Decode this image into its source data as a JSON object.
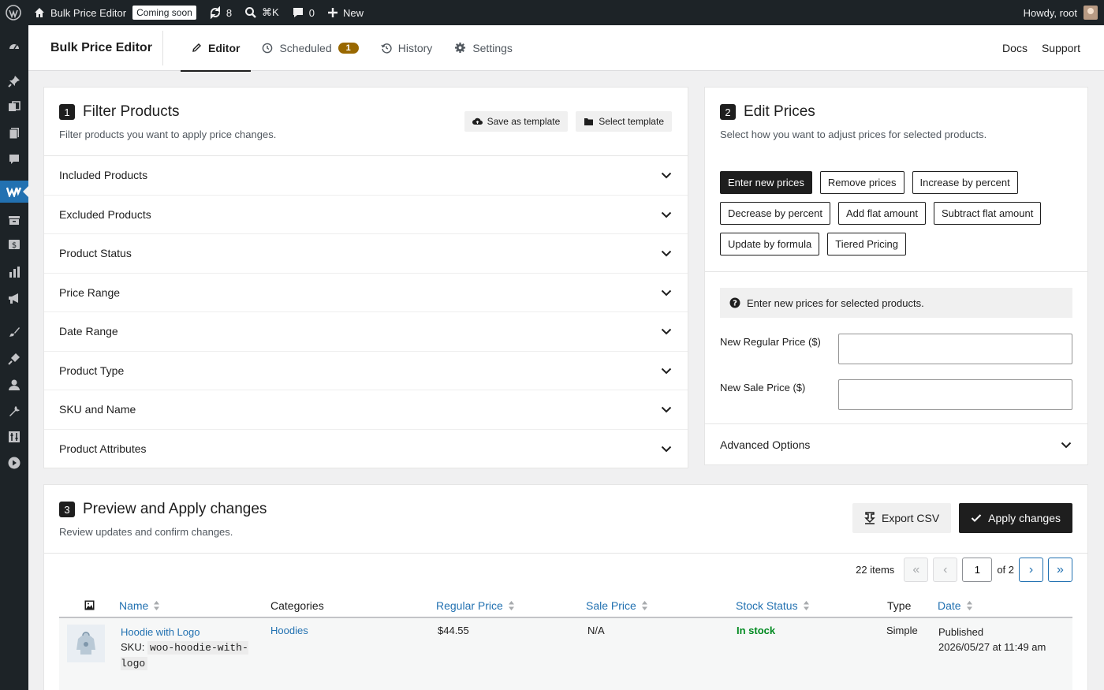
{
  "adminbar": {
    "site_name": "Bulk Price Editor",
    "badge": "Coming soon",
    "updates_count": "8",
    "search_shortcut": "⌘K",
    "comments_count": "0",
    "new_label": "New",
    "howdy": "Howdy, root"
  },
  "header": {
    "title": "Bulk Price Editor",
    "tabs": [
      {
        "label": "Editor",
        "icon": "pencil-icon"
      },
      {
        "label": "Scheduled",
        "icon": "clock-icon",
        "count": "1"
      },
      {
        "label": "History",
        "icon": "history-icon"
      },
      {
        "label": "Settings",
        "icon": "gear-icon"
      }
    ],
    "links": {
      "docs": "Docs",
      "support": "Support"
    }
  },
  "filter": {
    "step": "1",
    "title": "Filter Products",
    "subtitle": "Filter products you want to apply price changes.",
    "save_template": "Save as template",
    "select_template": "Select template",
    "sections": [
      "Included Products",
      "Excluded Products",
      "Product Status",
      "Price Range",
      "Date Range",
      "Product Type",
      "SKU and Name",
      "Product Attributes"
    ]
  },
  "edit": {
    "step": "2",
    "title": "Edit Prices",
    "subtitle": "Select how you want to adjust prices for selected products.",
    "modes": [
      "Enter new prices",
      "Remove prices",
      "Increase by percent",
      "Decrease by percent",
      "Add flat amount",
      "Subtract flat amount",
      "Update by formula",
      "Tiered Pricing"
    ],
    "active_mode": "Enter new prices",
    "info": "Enter new prices for selected products.",
    "regular_label": "New Regular Price ($)",
    "regular_value": "",
    "sale_label": "New Sale Price ($)",
    "sale_value": "",
    "advanced": "Advanced Options"
  },
  "preview": {
    "step": "3",
    "title": "Preview and Apply changes",
    "subtitle": "Review updates and confirm changes.",
    "export": "Export CSV",
    "apply": "Apply changes",
    "items": "22 items",
    "page": "1",
    "of": "of 2",
    "pager": {
      "first": "«",
      "prev": "‹",
      "next": "›",
      "last": "»"
    },
    "columns": {
      "name": "Name",
      "categories": "Categories",
      "regular": "Regular Price",
      "sale": "Sale Price",
      "stock": "Stock Status",
      "type": "Type",
      "date": "Date"
    },
    "rows": [
      {
        "name": "Hoodie with Logo",
        "sku_label": "SKU:",
        "sku": "woo-hoodie-with-logo",
        "category": "Hoodies",
        "regular": "$44.55",
        "sale": "N/A",
        "stock": "In stock",
        "type": "Simple",
        "date_status": "Published",
        "date": "2026/05/27 at 11:49 am"
      }
    ]
  },
  "colors": {
    "accent": "#2271b1",
    "dark": "#1e1e1e",
    "admin_bg": "#1d2327",
    "stock_ok": "#008a20",
    "badge": "#996800"
  }
}
